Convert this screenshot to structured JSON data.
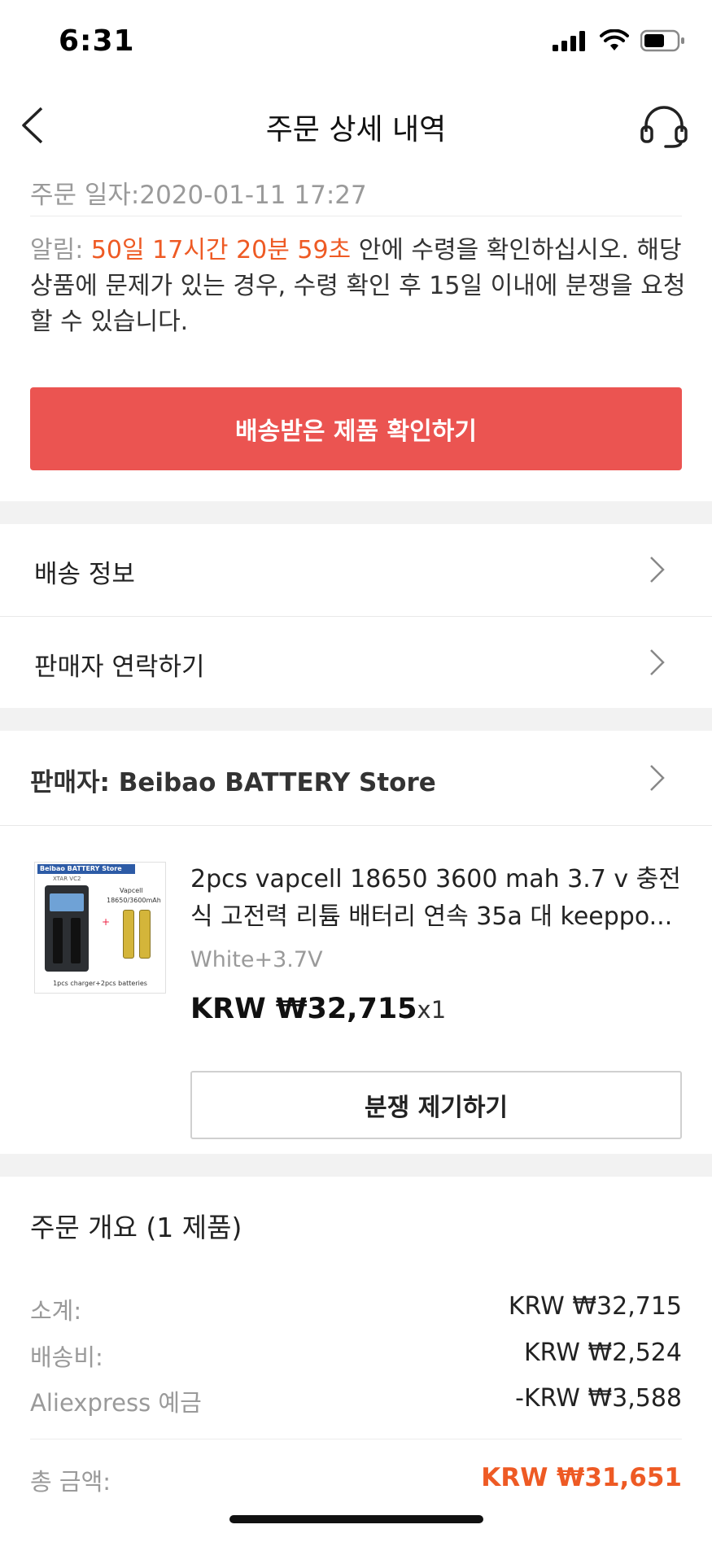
{
  "status_bar": {
    "time": "6:31"
  },
  "nav": {
    "title": "주문 상세 내역"
  },
  "order": {
    "date_label": "주문 일자:2020-01-11 17:27",
    "notice_label": "알림: ",
    "notice_countdown": "50일 17시간 20분 59초",
    "notice_text": " 안에 수령을 확인하십시오. 해당 상품에 문제가 있는 경우, 수령 확인 후 15일 이내에 분쟁을 요청할 수 있습니다.",
    "confirm_button": "배송받은 제품 확인하기"
  },
  "menu": {
    "shipping_info": "배송 정보",
    "contact_seller": "판매자 연락하기"
  },
  "seller": {
    "label": "판매자: Beibao BATTERY Store"
  },
  "product": {
    "title": "2pcs vapcell 18650 3600 mah 3.7 v 충전식 고전력 리튬 배터리 연속 35a 대 keeppo...",
    "variant": "White+3.7V",
    "price": "KRW ₩32,715",
    "qty": "x1",
    "dispute_button": "분쟁 제기하기",
    "thumbnail": {
      "banner": "Beibao BATTERY Store",
      "model": "XTAR VC2",
      "brand": "Vapcell",
      "spec": "18650/3600mAh",
      "caption": "1pcs charger+2pcs batteries"
    }
  },
  "summary": {
    "title": "주문 개요 (1 제품)",
    "subtotal_label": "소계:",
    "subtotal_value": "KRW ₩32,715",
    "shipping_label": "배송비:",
    "shipping_value": "KRW ₩2,524",
    "credit_label": "Aliexpress 예금",
    "credit_value": "-KRW ₩3,588",
    "total_label": "총 금액:",
    "total_value": "KRW ₩31,651"
  },
  "colors": {
    "accent": "#eb5451",
    "countdown": "#ee5a24",
    "muted": "#9a9a9a"
  }
}
